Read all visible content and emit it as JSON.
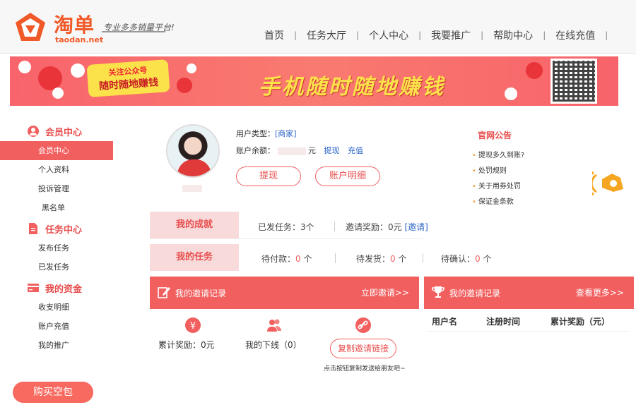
{
  "brand": {
    "logo_cn": "淘单",
    "logo_en": "taodan.net",
    "slogan": "专业多多销量平台!"
  },
  "nav": {
    "items": [
      "首页",
      "任务大厅",
      "个人中心",
      "我要推广",
      "帮助中心",
      "在线充值"
    ]
  },
  "banner": {
    "pill_top": "关注公众号",
    "pill_bottom": "随时随地赚钱",
    "headline": "手机随时随地赚钱"
  },
  "sidebar": {
    "groups": [
      {
        "title": "会员中心",
        "items": [
          "会员中心",
          "个人资料",
          "投诉管理",
          "黑名单"
        ]
      },
      {
        "title": "任务中心",
        "items": [
          "发布任务",
          "已发任务"
        ]
      },
      {
        "title": "我的资金",
        "items": [
          "收支明细",
          "账户充值",
          "我的推广"
        ]
      }
    ],
    "buy_button": "购买空包"
  },
  "profile": {
    "user_type_label": "用户类型：",
    "user_type_value": "[商家]",
    "balance_label": "账户余额：",
    "balance_unit": "元",
    "withdraw_link": "提现",
    "recharge_link": "充值",
    "withdraw_button": "提现",
    "detail_button": "账户明细"
  },
  "notices": {
    "title": "官网公告",
    "items": [
      "提现多久到账?",
      "处罚规则",
      "关于用券处罚",
      "保证金条款"
    ]
  },
  "achievement": {
    "label": "我的成就",
    "published": "已发任务：3个",
    "reward_text": "邀请奖励：0元",
    "invite_link": "[邀请]"
  },
  "tasks": {
    "label": "我的任务",
    "pending_pay_label": "待付款：",
    "pending_pay_value": "0",
    "pending_ship_label": "待发货：",
    "pending_ship_value": "0",
    "pending_confirm_label": "待确认：",
    "pending_confirm_value": "0",
    "unit": " 个"
  },
  "invite_panel": {
    "title": "我的邀请记录",
    "action": "立即邀请>>",
    "total_reward": "累计奖励：0元",
    "downline": "我的下线（0）",
    "copy_button": "复制邀请链接",
    "copy_hint": "点击按钮复制发送给朋友吧~"
  },
  "record_panel": {
    "title": "我的邀请记录",
    "action": "查看更多>>",
    "columns": [
      "用户名",
      "注册时间",
      "累计奖励（元）"
    ]
  },
  "colors": {
    "accent": "#f25f5f",
    "brand_orange": "#f05a28",
    "link_blue": "#2a63c8",
    "banner_yellow": "#fce24a"
  }
}
